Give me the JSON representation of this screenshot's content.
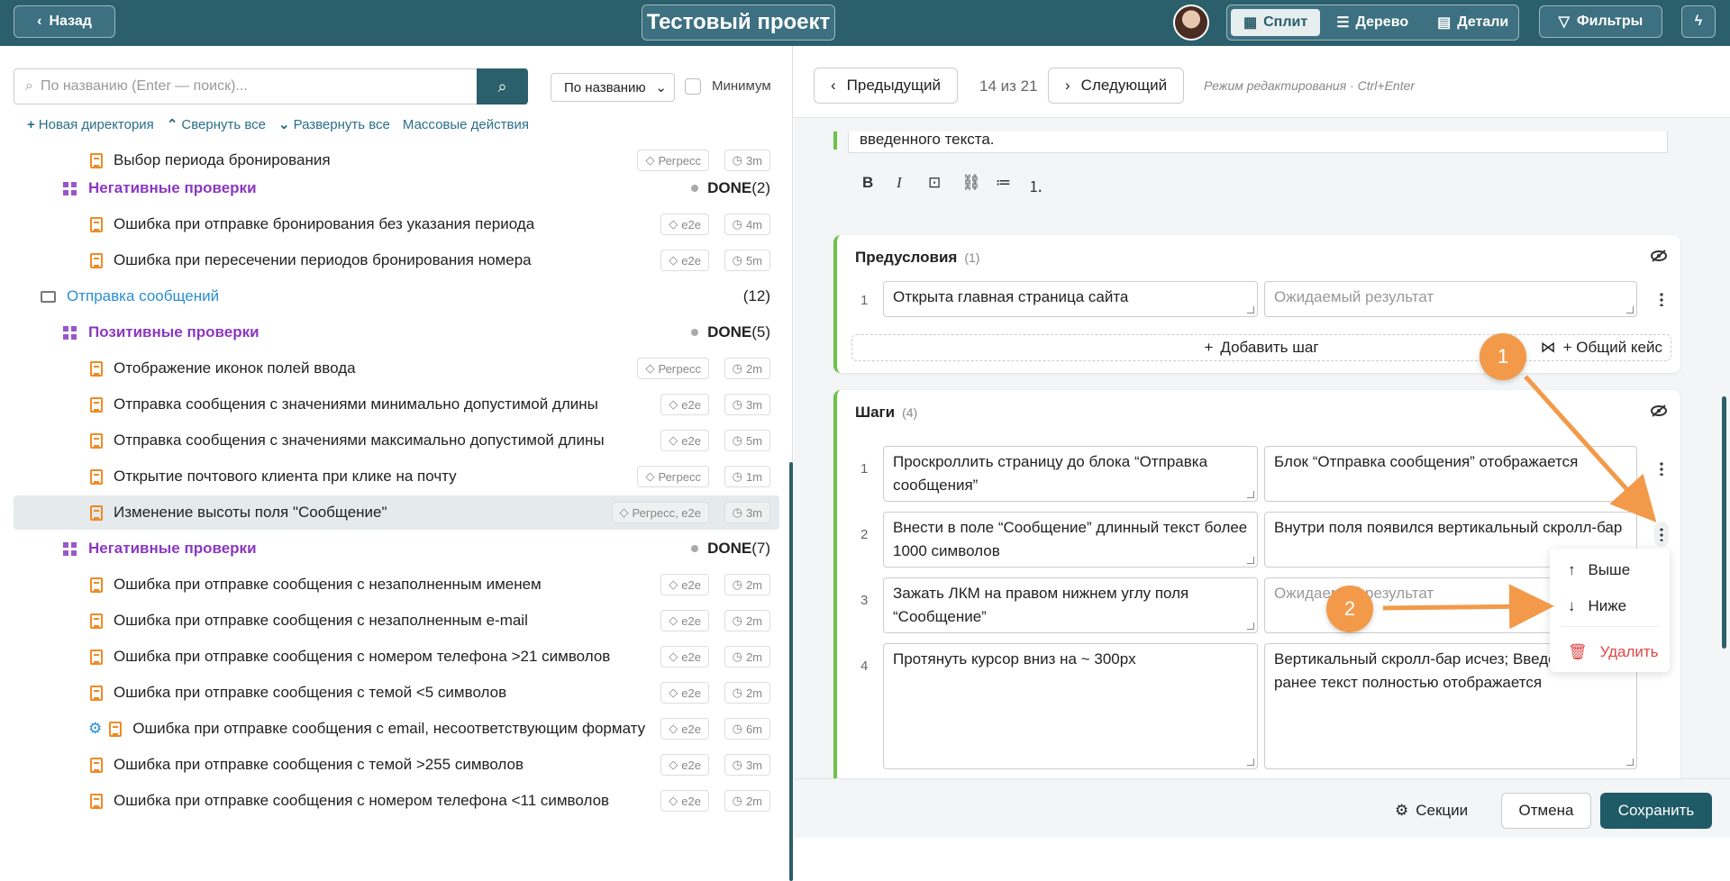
{
  "topbar": {
    "back_label": "Назад",
    "project_title": "Тестовый проект",
    "views": [
      {
        "label": "Сплит",
        "active": true
      },
      {
        "label": "Дерево",
        "active": false
      },
      {
        "label": "Детали",
        "active": false
      }
    ],
    "filters_label": "Фильтры"
  },
  "left": {
    "search_placeholder": "По названию (Enter — поиск)...",
    "sort_value": "По названию",
    "minimum_label": "Минимум",
    "actions": [
      "Новая директория",
      "Свернуть все",
      "Развернуть все",
      "Массовые действия"
    ],
    "rows": [
      {
        "kind": "case",
        "title": "Выбор периода бронирования",
        "tag": "Регресс",
        "time": "3m"
      },
      {
        "kind": "group",
        "title": "Негативные проверки",
        "status": "DONE",
        "count": "(2)"
      },
      {
        "kind": "case",
        "title": "Ошибка при отправке бронирования без указания периода",
        "tag": "e2e",
        "time": "4m"
      },
      {
        "kind": "case",
        "title": "Ошибка при пересечении периодов бронирования номера",
        "tag": "e2e",
        "time": "5m"
      },
      {
        "kind": "folder",
        "title": "Отправка сообщений",
        "count": "(12)"
      },
      {
        "kind": "group",
        "title": "Позитивные проверки",
        "status": "DONE",
        "count": "(5)"
      },
      {
        "kind": "case",
        "title": "Отображение иконок полей ввода",
        "tag": "Регресс",
        "time": "2m"
      },
      {
        "kind": "case",
        "title": "Отправка сообщения с значениями минимально допустимой длины",
        "tag": "e2e",
        "time": "3m"
      },
      {
        "kind": "case",
        "title": "Отправка сообщения с значениями максимально допустимой длины",
        "tag": "e2e",
        "time": "5m"
      },
      {
        "kind": "case",
        "title": "Открытие почтового клиента при клике на почту",
        "tag": "Регресс",
        "time": "1m"
      },
      {
        "kind": "case",
        "title": "Изменение высоты поля \"Сообщение\"",
        "tag": "Регресс, e2e",
        "time": "3m",
        "selected": true
      },
      {
        "kind": "group",
        "title": "Негативные проверки",
        "status": "DONE",
        "count": "(7)"
      },
      {
        "kind": "case",
        "title": "Ошибка при отправке сообщения с незаполненным именем",
        "tag": "e2e",
        "time": "2m"
      },
      {
        "kind": "case",
        "title": "Ошибка при отправке сообщения с незаполненным e-mail",
        "tag": "e2e",
        "time": "2m"
      },
      {
        "kind": "case",
        "title": "Ошибка при отправке сообщения с номером телефона >21 символов",
        "tag": "e2e",
        "time": "2m"
      },
      {
        "kind": "case",
        "title": "Ошибка при отправке сообщения с темой <5 символов",
        "tag": "e2e",
        "time": "2m"
      },
      {
        "kind": "case",
        "title": "Ошибка при отправке сообщения с email, несоответствующим формату",
        "tag": "e2e",
        "time": "6m",
        "gear": true
      },
      {
        "kind": "case",
        "title": "Ошибка при отправке сообщения с темой >255 символов",
        "tag": "e2e",
        "time": "3m"
      },
      {
        "kind": "case",
        "title": "Ошибка при отправке сообщения с номером телефона <11 символов",
        "tag": "e2e",
        "time": "2m"
      }
    ]
  },
  "right": {
    "prev_label": "Предыдущий",
    "position": "14 из 21",
    "next_label": "Следующий",
    "edit_hint": "Режим редактирования · Ctrl+Enter",
    "description_tail": "введенного текста.",
    "preconditions": {
      "title": "Предусловия",
      "count": "(1)",
      "steps": [
        {
          "n": "1",
          "action": "Открыта главная страница сайта",
          "result": "Ожидаемый результат"
        }
      ],
      "add_step": "Добавить шаг",
      "shared_case": "+ Общий кейс"
    },
    "steps": {
      "title": "Шаги",
      "count": "(4)",
      "items": [
        {
          "n": "1",
          "action": "Проскроллить страницу до блока “Отправка сообщения”",
          "result": "Блок “Отправка сообщения” отображается"
        },
        {
          "n": "2",
          "action": "Внести в поле “Сообщение” длинный текст более 1000 символов",
          "result": "Внутри поля появился вертикальный скролл-бар"
        },
        {
          "n": "3",
          "action": "Зажать ЛКМ на правом нижнем углу поля “Сообщение”",
          "result": "Ожидаемый результат"
        },
        {
          "n": "4",
          "action": "Протянуть курсор вниз на ~ 300px",
          "result": "Вертикальный скролл-бар исчез; Введенный ранее текст полностью отображается"
        }
      ]
    },
    "menu": {
      "up": "Выше",
      "down": "Ниже",
      "delete": "Удалить"
    },
    "badges": [
      "1",
      "2"
    ],
    "bottom": {
      "sections": "Секции",
      "cancel": "Отмена",
      "save": "Сохранить"
    }
  }
}
